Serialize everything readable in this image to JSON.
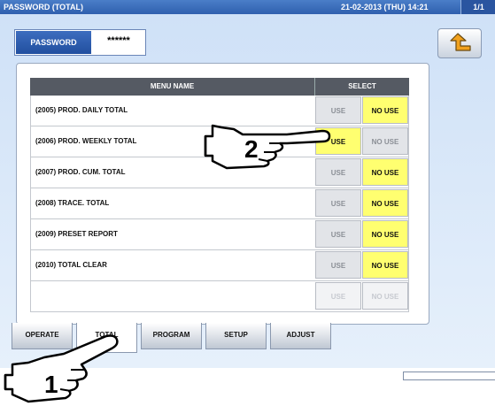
{
  "titlebar": {
    "title": "PASSWORD (TOTAL)",
    "datetime": "21-02-2013 (THU) 14:21",
    "page": "1/1"
  },
  "password": {
    "label": "PASSWORD",
    "value": "******"
  },
  "table": {
    "header_name": "MENU NAME",
    "header_select": "SELECT",
    "use_label": "USE",
    "nouse_label": "NO USE",
    "rows": [
      {
        "name": "(2005) PROD. DAILY TOTAL",
        "selected": "NO USE"
      },
      {
        "name": "(2006) PROD. WEEKLY TOTAL",
        "selected": "USE"
      },
      {
        "name": "(2007) PROD. CUM. TOTAL",
        "selected": "NO USE"
      },
      {
        "name": "(2008) TRACE. TOTAL",
        "selected": "NO USE"
      },
      {
        "name": "(2009) PRESET REPORT",
        "selected": "NO USE"
      },
      {
        "name": "(2010) TOTAL CLEAR",
        "selected": "NO USE"
      },
      {
        "name": "",
        "selected": ""
      }
    ]
  },
  "tabs": [
    "OPERATE",
    "TOTAL",
    "PROGRAM",
    "SETUP",
    "ADJUST"
  ],
  "active_tab": "TOTAL",
  "callouts": {
    "step1": "1",
    "step2": "2"
  },
  "icons": {
    "back": "back-arrow-icon",
    "pointer": "pointing-hand-icon"
  },
  "colors": {
    "title_bar": "#2f5fae",
    "selected": "#ffff70",
    "header": "#555a63"
  }
}
